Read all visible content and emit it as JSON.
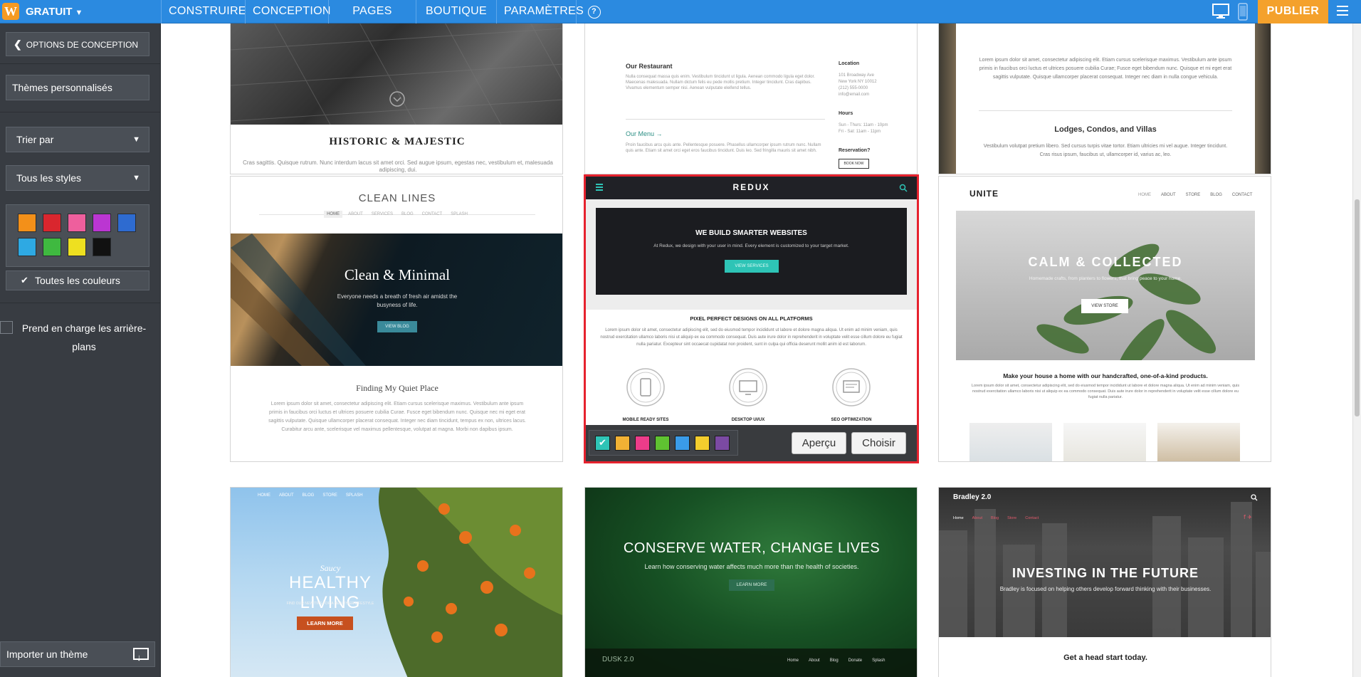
{
  "topbar": {
    "logo_letter": "W",
    "plan": "GRATUIT",
    "nav": [
      "CONSTRUIRE",
      "CONCEPTION",
      "PAGES",
      "BOUTIQUE",
      "PARAMÈTRES"
    ],
    "help": "?",
    "publish": "PUBLIER"
  },
  "sidebar": {
    "back": "OPTIONS DE CONCEPTION",
    "themes": "Thèmes personnalisés",
    "sort": "Trier par",
    "styles": "Tous les styles",
    "swatches": [
      "#f39019",
      "#d9262e",
      "#ee5f9d",
      "#bb36d2",
      "#2e6bd0",
      "#2ea9e3",
      "#3fb940",
      "#eee020",
      "#111111"
    ],
    "all_colors": "Toutes les couleurs",
    "backgrounds": "Prend en charge les arrière-plans",
    "import": "Importer un thème"
  },
  "themes": {
    "historic": {
      "title": "HISTORIC & MAJESTIC",
      "body": "Cras sagittis. Quisque rutrum. Nunc interdum lacus sit amet orci. Sed augue ipsum, egestas nec, vestibulum et, malesuada adipiscing, dui."
    },
    "restaurant": {
      "heading": "Our Restaurant",
      "menu": "Our Menu →",
      "location": "Location",
      "hours": "Hours",
      "reservation": "Reservation?",
      "book": "BOOK NOW",
      "addr1": "101 Broadway Ave",
      "addr2": "New York NY 10012",
      "addr3": "(212) 555-0000",
      "addr4": "info@email.com",
      "hours1": "Sun - Thurs: 11am - 10pm",
      "hours2": "Fri - Sat: 11am - 11pm"
    },
    "lodges": {
      "heading": "Lodges, Condos, and Villas",
      "body1": "Lorem ipsum dolor sit amet, consectetur adipiscing elit. Etiam cursus scelerisque maximus. Vestibulum ante ipsum primis in faucibus orci luctus et ultrices posuere cubilia Curae; Fusce eget bibendum nunc. Quisque et mi eget erat sagittis vulputate. Quisque ullamcorper placerat consequat. Integer nec diam in nulla congue vehicula.",
      "body2": "Vestibulum volutpat pretium libero. Sed cursus turpis vitae tortor. Etiam ultricies mi vel augue. Integer tincidunt. Cras risus ipsum, faucibus ut, ullamcorper id, varius ac, leo."
    },
    "clean": {
      "title": "CLEAN LINES",
      "nav": [
        "HOME",
        "ABOUT",
        "SERVICES",
        "BLOG",
        "CONTACT",
        "SPLASH"
      ],
      "hero": "Clean & Minimal",
      "sub": "Everyone needs a breath of fresh air amidst the busyness of life.",
      "btn": "VIEW BLOG",
      "section": "Finding My Quiet Place",
      "body": "Lorem ipsum dolor sit amet, consectetur adipiscing elit. Etiam cursus scelerisque maximus. Vestibulum ante ipsum primis in faucibus orci luctus et ultrices posuere cubilia Curae. Fusce eget bibendum nunc. Quisque nec mi eget erat sagittis vulputate. Quisque ullamcorper placerat consequat. Integer nec diam tincidunt, tempus ex non, ultrices lacus. Curabitur arcu ante, scelerisque vel maximus pellentesque, volutpat at magna. Morbi non dapibus ipsum."
    },
    "redux": {
      "brand": "REDUX",
      "hero_title": "WE BUILD SMARTER WEBSITES",
      "hero_sub": "At Redux, we design with your user in mind. Every element is customized to your target market.",
      "hero_btn": "VIEW SERVICES",
      "section": "PIXEL PERFECT DESIGNS ON ALL PLATFORMS",
      "body": "Lorem ipsum dolor sit amet, consectetur adipiscing elit, sed do eiusmod tempor incididunt ut labore et dolore magna aliqua. Ut enim ad minim veniam, quis nostrud exercitation ullamco laboris nisi ut aliquip ex ea commodo consequat. Duis aute irure dolor in reprehenderit in voluptate velit esse cillum dolore eu fugiat nulla pariatur. Excepteur sint occaecat cupidatat non proident, sunt in culpa qui officia deserunt mollit anim id est laborum.",
      "features": [
        "MOBILE READY SITES",
        "DESKTOP UI/UX",
        "SEO OPTIMIZATION"
      ],
      "palette": [
        "#2ec4b6",
        "#f2b134",
        "#ec3c8a",
        "#5fc231",
        "#3a9be8",
        "#f4cd2d",
        "#7b4aa3"
      ],
      "preview": "Aperçu",
      "choose": "Choisir"
    },
    "unite": {
      "brand": "UNITE",
      "nav": [
        "HOME",
        "ABOUT",
        "STORE",
        "BLOG",
        "CONTACT"
      ],
      "hero": "CALM & COLLECTED",
      "sub": "Homemade crafts, from planters to flowers, that bring peace to your home.",
      "btn": "VIEW STORE",
      "section": "Make your house a home with our handcrafted, one-of-a-kind products.",
      "body": "Lorem ipsum dolor sit amet, consectetur adipiscing elit, sed do eiusmod tempor incididunt ut labore et dolore magna aliqua. Ut enim ad minim veniam, quis nostrud exercitation ullamco laboris nisi ut aliquip ex ea commodo consequat. Duis aute irure dolor in reprehenderit in voluptate velit esse cillum dolore eu fugiat nulla pariatur."
    },
    "healthy": {
      "nav": [
        "HOME",
        "ABOUT",
        "BLOG",
        "STORE",
        "SPLASH"
      ],
      "script": "Saucy",
      "title": "HEALTHY LIVING",
      "sub": "FIND OUR NEW TIPS FOR A HEALTHIER LIFESTYLE",
      "btn": "LEARN MORE"
    },
    "dusk": {
      "title": "CONSERVE WATER, CHANGE LIVES",
      "sub": "Learn how conserving water affects much more than the health of societies.",
      "btn": "LEARN MORE",
      "brand": "DUSK 2.0",
      "nav": [
        "Home",
        "About",
        "Blog",
        "Donate",
        "Splash"
      ]
    },
    "bradley": {
      "brand": "Bradley 2.0",
      "nav": [
        "Home",
        "About",
        "Blog",
        "Store",
        "Contact"
      ],
      "title": "INVESTING IN THE FUTURE",
      "sub": "Bradley is focused on helping others develop forward thinking with their businesses.",
      "section": "Get a head start today."
    }
  }
}
